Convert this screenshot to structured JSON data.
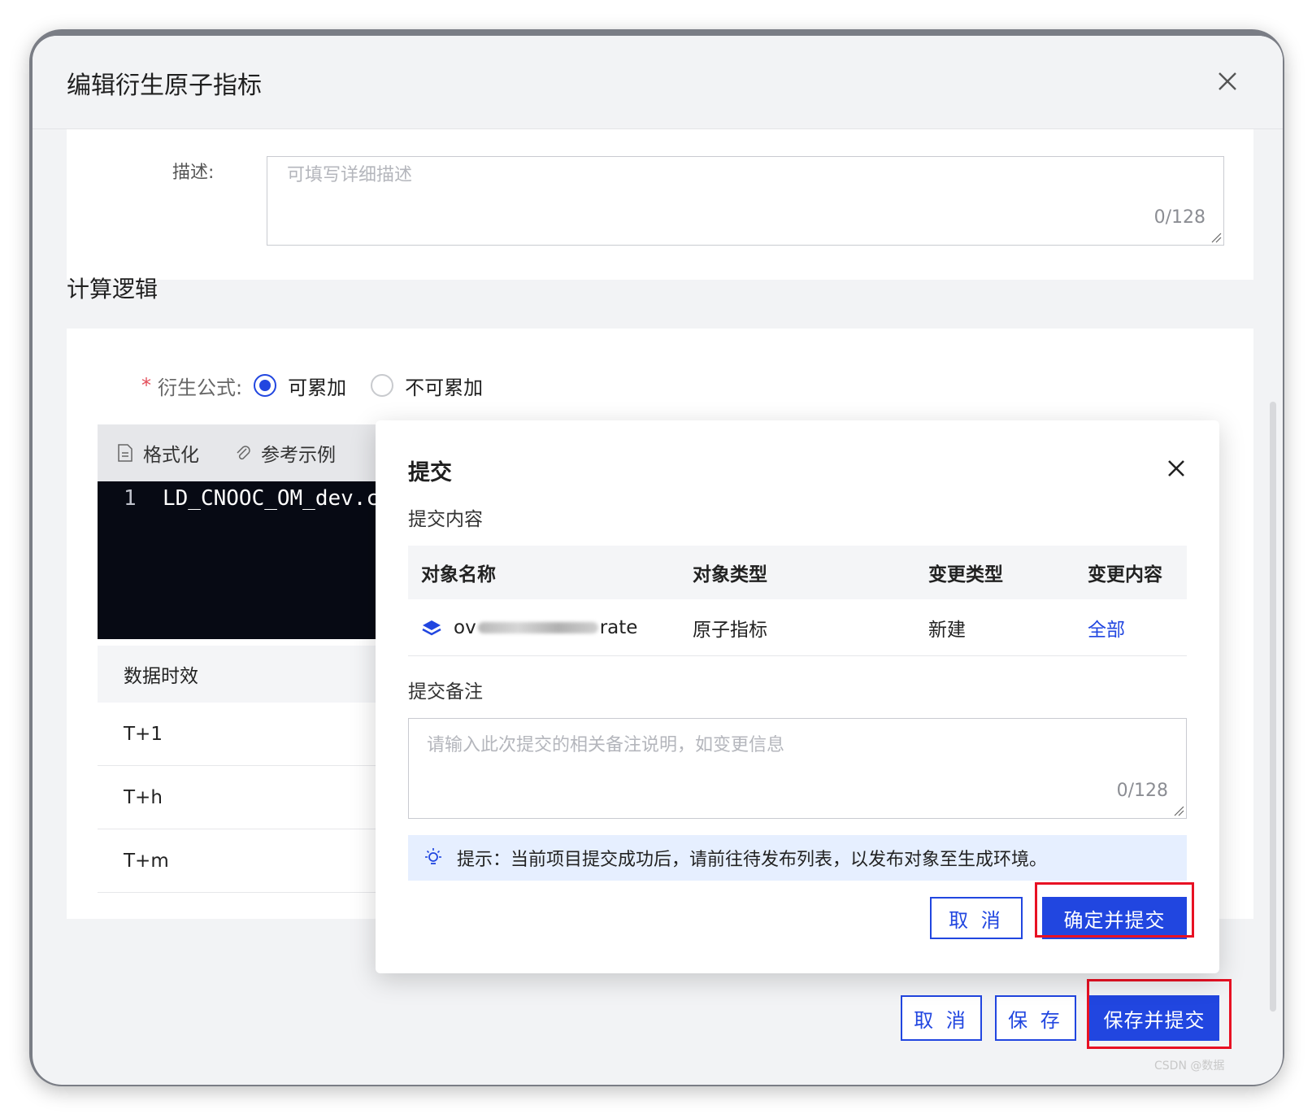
{
  "drawer": {
    "title": "编辑衍生原子指标",
    "description_label": "描述:",
    "description_placeholder": "可填写详细描述",
    "description_count": "0/128",
    "section_title": "计算逻辑",
    "formula_label": "衍生公式:",
    "formula_required_mark": "*",
    "formula_options": [
      {
        "label": "可累加",
        "selected": true
      },
      {
        "label": "不可累加",
        "selected": false
      }
    ],
    "editor_toolbar": {
      "format_label": "格式化",
      "example_label": "参考示例"
    },
    "editor": {
      "line_number": "1",
      "code": "LD_CNOOC_OM_dev.c"
    },
    "timeliness": {
      "header": "数据时效",
      "rows": [
        "T+1",
        "T+h",
        "T+m"
      ]
    },
    "footer": {
      "cancel_label": "取 消",
      "save_label": "保 存",
      "save_submit_label": "保存并提交"
    }
  },
  "dialog": {
    "title": "提交",
    "content_label": "提交内容",
    "columns": [
      "对象名称",
      "对象类型",
      "变更类型",
      "变更内容"
    ],
    "rows": [
      {
        "name_prefix": "ov",
        "name_suffix": "rate",
        "type": "原子指标",
        "change_type": "新建",
        "change_content": "全部"
      }
    ],
    "note_label": "提交备注",
    "note_placeholder": "请输入此次提交的相关备注说明，如变更信息",
    "note_count": "0/128",
    "tip": "提示：当前项目提交成功后，请前往待发布列表，以发布对象至生成环境。",
    "cancel_label": "取 消",
    "confirm_label": "确定并提交"
  },
  "colors": {
    "primary": "#2146e0",
    "highlight_box": "#e81123",
    "tip_background": "#e6efff"
  },
  "watermark": "CSDN @数据"
}
